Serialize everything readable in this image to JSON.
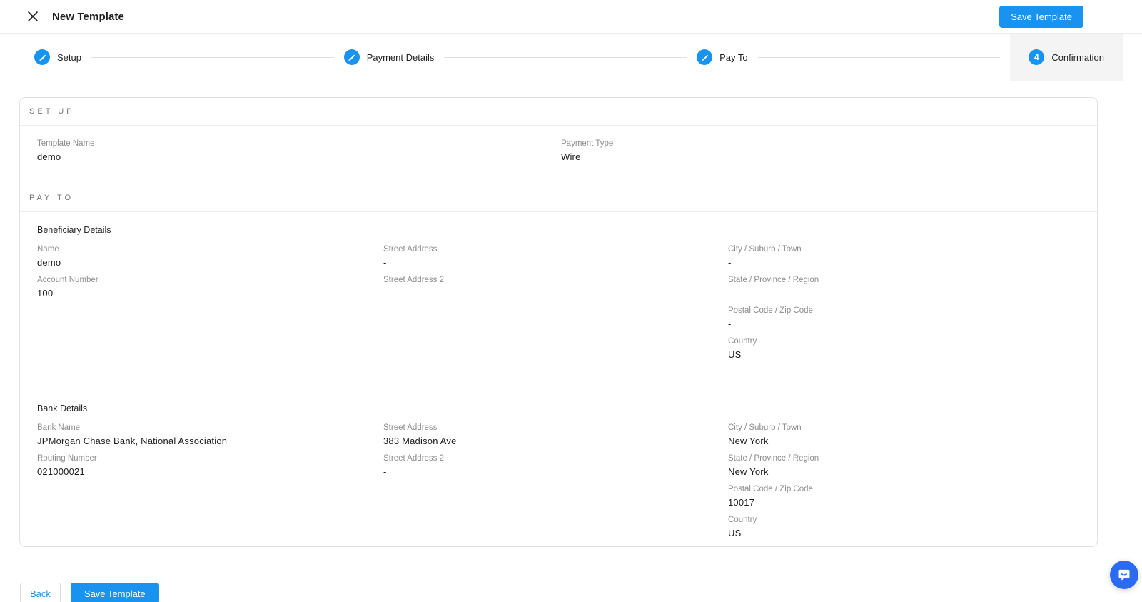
{
  "colors": {
    "accent": "#1894f0",
    "current_step_background": "#f4f4f4",
    "chat_launcher": "#2a6bf2"
  },
  "header": {
    "title": "New Template",
    "save_button_label": "Save Template"
  },
  "stepper": {
    "steps": [
      {
        "label": "Setup",
        "icon": "pencil",
        "current": false
      },
      {
        "label": "Payment Details",
        "icon": "pencil",
        "current": false
      },
      {
        "label": "Pay To",
        "icon": "pencil",
        "current": false
      },
      {
        "label": "Confirmation",
        "icon": "step-number",
        "number": "4",
        "current": true
      }
    ]
  },
  "setup_section": {
    "heading": "SET UP",
    "fields": [
      {
        "label": "Template Name",
        "value": "demo"
      },
      {
        "label": "Payment Type",
        "value": "Wire"
      }
    ]
  },
  "pay_to_section": {
    "heading": "PAY TO",
    "beneficiary": {
      "title": "Beneficiary Details",
      "col1": [
        {
          "label": "Name",
          "value": "demo"
        },
        {
          "label": "Account Number",
          "value": "100"
        }
      ],
      "col2": [
        {
          "label": "Street Address",
          "value": "-"
        },
        {
          "label": "Street Address 2",
          "value": "-"
        }
      ],
      "col3": [
        {
          "label": "City / Suburb / Town",
          "value": "-"
        },
        {
          "label": "State / Province / Region",
          "value": "-"
        },
        {
          "label": "Postal Code / Zip Code",
          "value": "-"
        },
        {
          "label": "Country",
          "value": "US"
        }
      ]
    },
    "bank": {
      "title": "Bank Details",
      "col1": [
        {
          "label": "Bank Name",
          "value": "JPMorgan Chase Bank, National Association"
        },
        {
          "label": "Routing Number",
          "value": "021000021"
        }
      ],
      "col2": [
        {
          "label": "Street Address",
          "value": "383 Madison Ave"
        },
        {
          "label": "Street Address 2",
          "value": "-"
        }
      ],
      "col3": [
        {
          "label": "City / Suburb / Town",
          "value": "New York"
        },
        {
          "label": "State / Province / Region",
          "value": "New York"
        },
        {
          "label": "Postal Code / Zip Code",
          "value": "10017"
        },
        {
          "label": "Country",
          "value": "US"
        }
      ]
    }
  },
  "footer": {
    "back_label": "Back",
    "save_label": "Save Template"
  }
}
